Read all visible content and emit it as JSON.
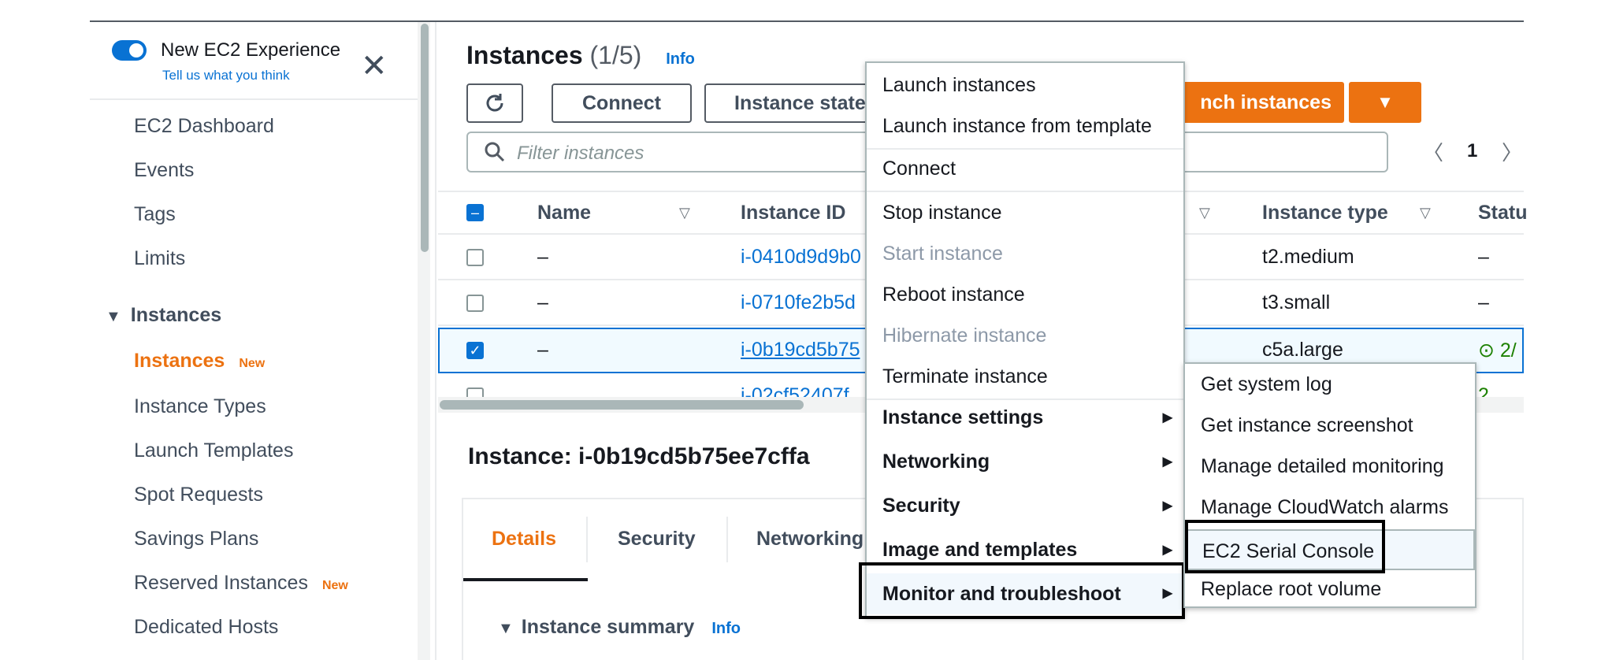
{
  "sidebar": {
    "new_experience": "New EC2 Experience",
    "tell_us": "Tell us what you think",
    "items_top": [
      "EC2 Dashboard",
      "Events",
      "Tags",
      "Limits"
    ],
    "section": "Instances",
    "instances_item": "Instances",
    "instances_badge": "New",
    "items_sub": [
      "Instance Types",
      "Launch Templates",
      "Spot Requests",
      "Savings Plans"
    ],
    "reserved": "Reserved Instances",
    "reserved_badge": "New",
    "dedicated": "Dedicated Hosts"
  },
  "header": {
    "title": "Instances",
    "count": "(1/5)",
    "info": "Info",
    "connect": "Connect",
    "instance_state": "Instance state",
    "launch": "nch instances",
    "filter_placeholder": "Filter instances",
    "page": "1"
  },
  "table": {
    "columns": [
      "Name",
      "Instance ID",
      "Instance type",
      "Statu"
    ],
    "rows": [
      {
        "name": "–",
        "id": "i-0410d9d9b0",
        "type": "t2.medium",
        "status": "–"
      },
      {
        "name": "–",
        "id": "i-0710fe2b5d",
        "type": "t3.small",
        "status": "–"
      },
      {
        "name": "–",
        "id": "i-0b19cd5b75",
        "type": "c5a.large",
        "status": "2/"
      },
      {
        "name": "",
        "id": "i-02cf52407f",
        "type": "",
        "status": "2"
      }
    ]
  },
  "details": {
    "title": "Instance: i-0b19cd5b75ee7cffa",
    "tabs": [
      "Details",
      "Security",
      "Networking"
    ],
    "summary": "Instance summary",
    "summary_info": "Info"
  },
  "menu": {
    "items": [
      "Launch instances",
      "Launch instance from template",
      "Connect",
      "Stop instance",
      "Start instance",
      "Reboot instance",
      "Hibernate instance",
      "Terminate instance"
    ],
    "submenus": [
      "Instance settings",
      "Networking",
      "Security",
      "Image and templates",
      "Monitor and troubleshoot"
    ]
  },
  "submenu": {
    "items": [
      "Get system log",
      "Get instance screenshot",
      "Manage detailed monitoring",
      "Manage CloudWatch alarms",
      "EC2 Serial Console",
      "Replace root volume"
    ]
  },
  "colors": {
    "accent": "#ec7211",
    "link": "#0972d3"
  }
}
